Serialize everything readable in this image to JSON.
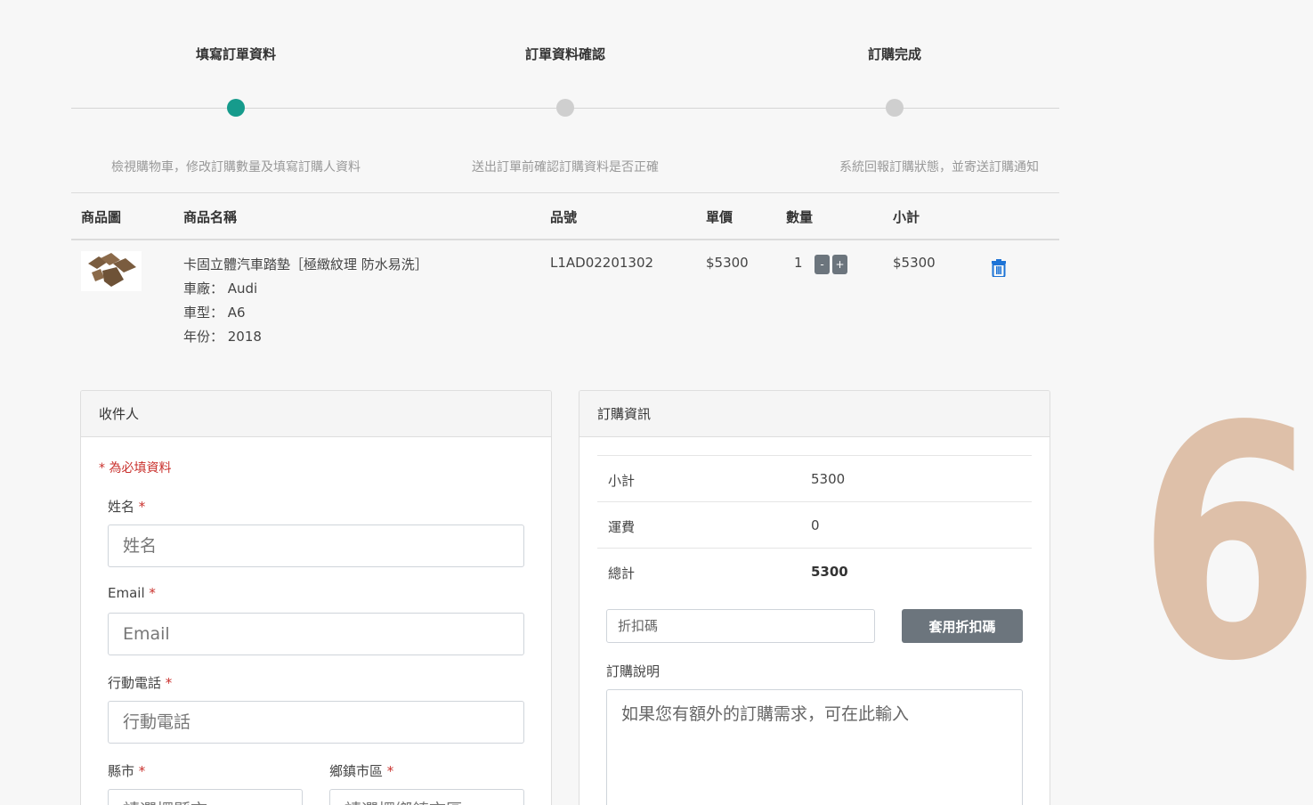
{
  "steps": [
    {
      "title": "填寫訂單資料",
      "desc": "檢視購物車，修改訂購數量及填寫訂購人資料",
      "active": true
    },
    {
      "title": "訂單資料確認",
      "desc": "送出訂單前確認訂購資料是否正確",
      "active": false
    },
    {
      "title": "訂購完成",
      "desc": "系統回報訂購狀態，並寄送訂購通知",
      "active": false
    }
  ],
  "cart": {
    "headers": [
      "商品圖",
      "商品名稱",
      "品號",
      "單價",
      "數量",
      "小計"
    ],
    "item": {
      "name": "卡固立體汽車踏墊［極緻紋理 防水易洗］",
      "brand": "車廠： Audi",
      "model": "車型： A6",
      "year": "年份： 2018",
      "sku": "L1AD02201302",
      "price": "$5300",
      "qty": "1",
      "minus": "-",
      "plus": "+",
      "subtotal": "$5300"
    }
  },
  "recipient": {
    "title": "收件人",
    "required_note": "* 為必填資料",
    "star": "*",
    "name_label": "姓名",
    "name_placeholder": "姓名",
    "email_label": "Email",
    "email_placeholder": "Email",
    "phone_label": "行動電話",
    "phone_placeholder": "行動電話",
    "county_label": "縣市",
    "county_placeholder": "請選擇縣市",
    "town_label": "鄉鎮市區",
    "town_placeholder": "請選擇鄉鎮市區"
  },
  "order_info": {
    "title": "訂購資訊",
    "rows": [
      {
        "label": "小計",
        "value": "5300"
      },
      {
        "label": "運費",
        "value": "0"
      },
      {
        "label": "總計",
        "value": "5300"
      }
    ],
    "coupon_placeholder": "折扣碼",
    "coupon_button": "套用折扣碼",
    "note_label": "訂購說明",
    "note_placeholder": "如果您有額外的訂購需求，可在此輸入"
  },
  "overlay_number": "6",
  "colors": {
    "active_step": "#169b8c",
    "required": "#c9302c",
    "button": "#6c757d",
    "trash": "#1e74d6",
    "overlay": "#dec0a9"
  }
}
